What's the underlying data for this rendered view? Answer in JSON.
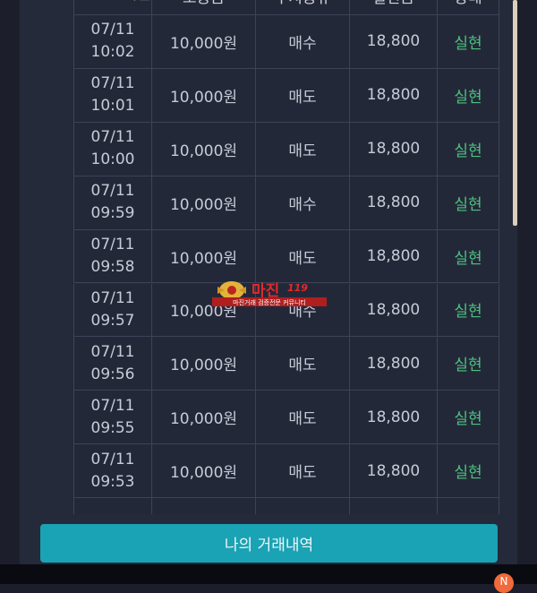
{
  "table": {
    "headers": [
      "시간",
      "보증금",
      "주지종류",
      "실현금",
      "상태"
    ],
    "rows": [
      {
        "date": "07/11",
        "time": "10:02",
        "amount": "10,000원",
        "type": "매수",
        "price": "18,800",
        "status": "실현"
      },
      {
        "date": "07/11",
        "time": "10:01",
        "amount": "10,000원",
        "type": "매도",
        "price": "18,800",
        "status": "실현"
      },
      {
        "date": "07/11",
        "time": "10:00",
        "amount": "10,000원",
        "type": "매도",
        "price": "18,800",
        "status": "실현"
      },
      {
        "date": "07/11",
        "time": "09:59",
        "amount": "10,000원",
        "type": "매수",
        "price": "18,800",
        "status": "실현"
      },
      {
        "date": "07/11",
        "time": "09:58",
        "amount": "10,000원",
        "type": "매도",
        "price": "18,800",
        "status": "실현"
      },
      {
        "date": "07/11",
        "time": "09:57",
        "amount": "10,000원",
        "type": "매수",
        "price": "18,800",
        "status": "실현"
      },
      {
        "date": "07/11",
        "time": "09:56",
        "amount": "10,000원",
        "type": "매도",
        "price": "18,800",
        "status": "실현"
      },
      {
        "date": "07/11",
        "time": "09:55",
        "amount": "10,000원",
        "type": "매도",
        "price": "18,800",
        "status": "실현"
      },
      {
        "date": "07/11",
        "time": "09:53",
        "amount": "10,000원",
        "type": "매도",
        "price": "18,800",
        "status": "실현"
      },
      {
        "date": "07/11",
        "time": "",
        "amount": "",
        "type": "",
        "price": "",
        "status": ""
      }
    ]
  },
  "watermark": {
    "brand": "마진",
    "suffix": "119",
    "tagline": "마진거래 검증전문 커뮤니티"
  },
  "footer_button": {
    "label": "나의 거래내역"
  },
  "notification": {
    "badge": "N"
  },
  "colors": {
    "accent": "#1aa3b4",
    "status": "#4ec27d",
    "badge": "#f06a3b"
  }
}
